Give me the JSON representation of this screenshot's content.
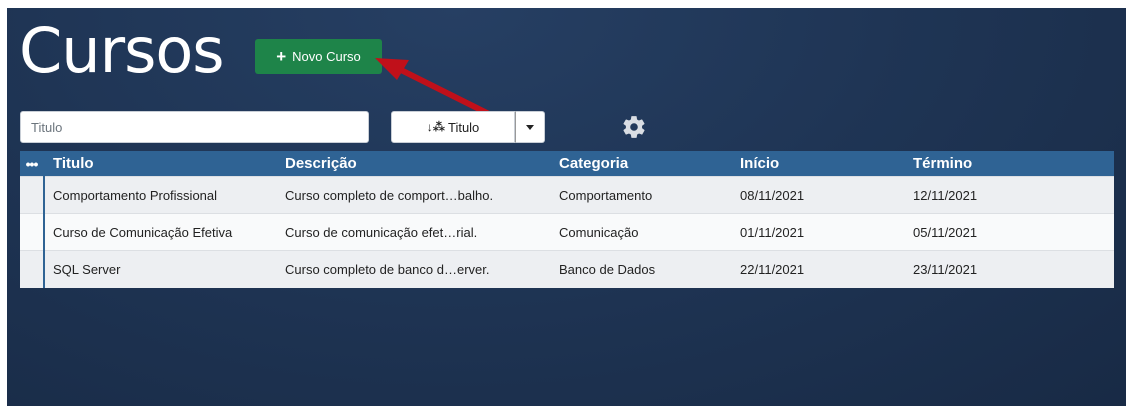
{
  "page": {
    "title": "Cursos"
  },
  "toolbar": {
    "new_course_label": "Novo Curso",
    "new_course_icon": "plus-icon",
    "search_placeholder": "Titulo",
    "search_value": "",
    "sort_label": "Titulo",
    "sort_icon": "sort-ascending-icon",
    "settings_icon": "gear-icon"
  },
  "colors": {
    "primary_header": "#2f6394",
    "new_button": "#1e8449",
    "annotation_arrow": "#c0101a"
  },
  "table": {
    "columns": [
      "•••",
      "Titulo",
      "Descrição",
      "Categoria",
      "Início",
      "Término"
    ],
    "rows": [
      {
        "titulo": "Comportamento Profissional",
        "descricao": "Curso completo de comport…balho.",
        "categoria": "Comportamento",
        "inicio": "08/11/2021",
        "termino": "12/11/2021"
      },
      {
        "titulo": "Curso de Comunicação Efetiva",
        "descricao": "Curso de comunicação efet…rial.",
        "categoria": "Comunicação",
        "inicio": "01/11/2021",
        "termino": "05/11/2021"
      },
      {
        "titulo": "SQL Server",
        "descricao": "Curso completo de banco d…erver.",
        "categoria": "Banco de Dados",
        "inicio": "22/11/2021",
        "termino": "23/11/2021"
      }
    ]
  }
}
